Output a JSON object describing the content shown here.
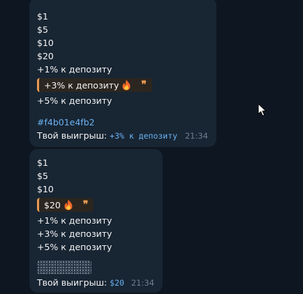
{
  "messages": [
    {
      "lines_before": [
        "$1",
        "$5",
        "$10",
        "$20",
        "+1% к депозиту"
      ],
      "quote": "+3% к депозиту",
      "lines_after": [
        "+5% к депозиту"
      ],
      "hashtag": "#f4b01e4fb2",
      "result_label": "Твой выигрыш:",
      "result_value": "+3% к депозиту",
      "time": "21:34"
    },
    {
      "lines_before": [
        "$1",
        "$5",
        "$10"
      ],
      "quote": "$20",
      "lines_after": [
        "+1% к депозиту",
        "+3% к депозиту",
        "+5% к депозиту"
      ],
      "spoiler": "hidden",
      "result_label": "Твой выигрыш:",
      "result_value": "$20",
      "time": "21:34"
    }
  ],
  "icons": {
    "quote_emoji": "fire-icon",
    "quote_mark": "quote-icon",
    "pointer": "mouse-cursor"
  },
  "colors": {
    "chat_background": "#0e1621",
    "bubble_background": "#182533",
    "accent_link": "#6ab2f2",
    "quote_accent": "#e99b50",
    "quote_background": "#2b2620",
    "timestamp": "#6d7f8f"
  }
}
